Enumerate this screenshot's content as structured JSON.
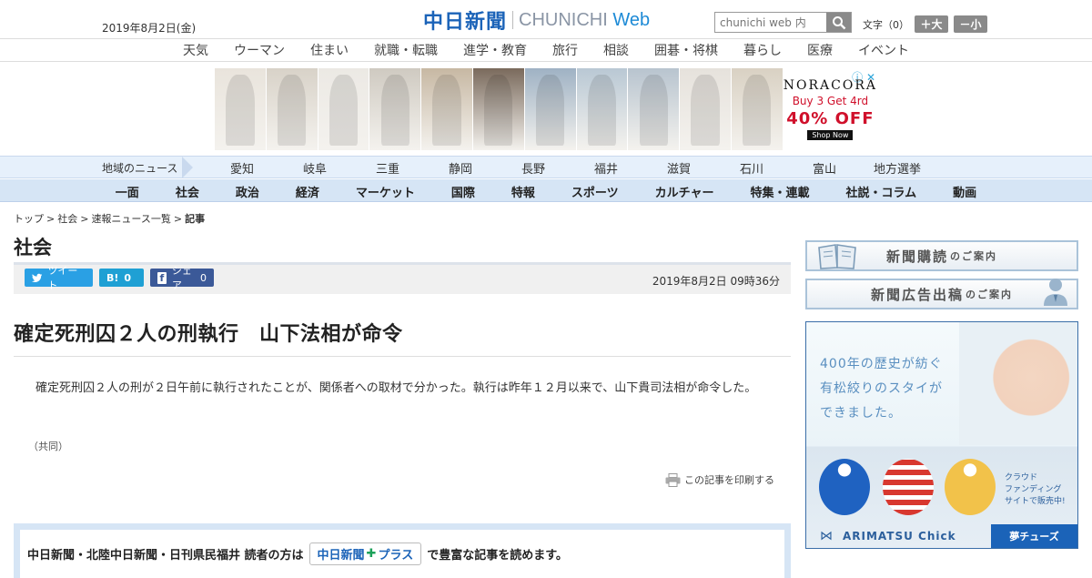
{
  "header": {
    "date": "2019年8月2日(金)",
    "logo_jp": "中日新聞",
    "logo_en_a": "CHUNICHI",
    "logo_en_b": "Web",
    "search_placeholder": "chunichi web 内",
    "fontsize_label": "文字（0）",
    "fontsize_up": "＋大",
    "fontsize_down": "－小"
  },
  "category_nav": [
    "天気",
    "ウーマン",
    "住まい",
    "就職・転職",
    "進学・教育",
    "旅行",
    "相談",
    "囲碁・将棋",
    "暮らし",
    "医療",
    "イベント"
  ],
  "ad": {
    "brand": "NORACORA",
    "line1": "Buy 3 Get 4rd",
    "line2": "40% OFF",
    "cta": "Shop Now",
    "tile_colors": [
      "#e9e4dc",
      "#d8d2c8",
      "#ece9e4",
      "#cfcac1",
      "#c7b8a3",
      "#7a6a5c",
      "#9fb2c4",
      "#b9c8d4",
      "#b8c4cf",
      "#e6e2dc",
      "#d9d1c3"
    ]
  },
  "regional_nav": {
    "label": "地域のニュース",
    "items": [
      "愛知",
      "岐阜",
      "三重",
      "静岡",
      "長野",
      "福井",
      "滋賀",
      "石川",
      "富山",
      "地方選挙"
    ]
  },
  "main_nav": [
    "一面",
    "社会",
    "政治",
    "経済",
    "マーケット",
    "国際",
    "特報",
    "スポーツ",
    "カルチャー",
    "特集・連載",
    "社説・コラム",
    "動画"
  ],
  "breadcrumb": {
    "items": [
      "トップ",
      "社会",
      "速報ニュース一覧"
    ],
    "current": "記事",
    "sep": ">"
  },
  "section_title": "社会",
  "share": {
    "tweet": "ツイート",
    "hatena_label": "B!",
    "hatena_count": "0",
    "fb_label": "シェア",
    "fb_count": "0"
  },
  "article": {
    "timestamp": "2019年8月2日 09時36分",
    "headline": "確定死刑囚２人の刑執行　山下法相が命令",
    "body": "確定死刑囚２人の刑が２日午前に執行されたことが、関係者への取材で分かった。執行は昨年１２月以来で、山下貴司法相が命令した。",
    "source": "（共同）",
    "print_label": "この記事を印刷する"
  },
  "plus_promo": {
    "lead": "中日新聞・北陸中日新聞・日刊県民福井 読者の方は",
    "logo_a": "中日新聞",
    "logo_b": "プラス",
    "tail": "で豊富な記事を読めます。"
  },
  "sidebar": {
    "subscribe_label": "新聞購読",
    "subscribe_small": "のご案内",
    "adplace_label": "新聞広告出稿",
    "adplace_small": "のご案内",
    "ad_line1": "400年の歴史が紡ぐ",
    "ad_line2": "有松絞りのスタイが",
    "ad_line3": "できました。",
    "ad_crowd1": "クラウド",
    "ad_crowd2": "ファンディング",
    "ad_crowd3": "サイトで販売中!",
    "ad_brand": "ARIMATSU Chick",
    "ad_dream": "夢チューズ"
  }
}
